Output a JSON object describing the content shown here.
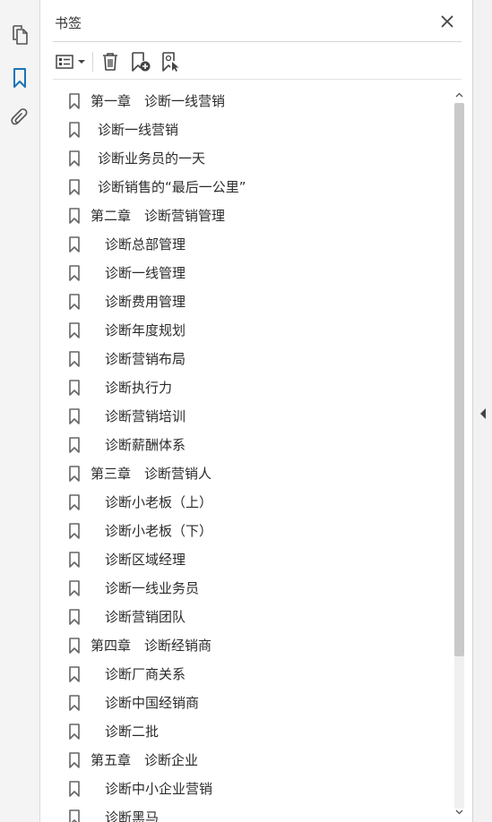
{
  "panel": {
    "title": "书签"
  },
  "rail": {
    "items": [
      {
        "name": "pages-icon"
      },
      {
        "name": "bookmarks-icon"
      },
      {
        "name": "attachments-icon"
      }
    ]
  },
  "toolbar": {
    "options_icon": "list-options-icon",
    "delete_icon": "trash-icon",
    "new_bookmark_icon": "new-bookmark-icon",
    "bookmark_from_selection_icon": "bookmark-from-selection-icon"
  },
  "colors": {
    "accent": "#1a73b8",
    "icon_gray": "#555555",
    "rail_bg": "#f4f4f4"
  },
  "bookmarks": [
    {
      "label": "第一章　诊断一线营销",
      "level": 0
    },
    {
      "label": "诊断一线营销",
      "level": 1
    },
    {
      "label": "诊断业务员的一天",
      "level": 1
    },
    {
      "label": "诊断销售的“最后一公里”",
      "level": 1
    },
    {
      "label": "第二章　诊断营销管理",
      "level": 0
    },
    {
      "label": "诊断总部管理",
      "level": 2
    },
    {
      "label": "诊断一线管理",
      "level": 2
    },
    {
      "label": "诊断费用管理",
      "level": 2
    },
    {
      "label": "诊断年度规划",
      "level": 2
    },
    {
      "label": "诊断营销布局",
      "level": 2
    },
    {
      "label": "诊断执行力",
      "level": 2
    },
    {
      "label": "诊断营销培训",
      "level": 2
    },
    {
      "label": "诊断薪酬体系",
      "level": 2
    },
    {
      "label": "第三章　诊断营销人",
      "level": 0
    },
    {
      "label": "诊断小老板（上）",
      "level": 2
    },
    {
      "label": "诊断小老板（下）",
      "level": 2
    },
    {
      "label": "诊断区域经理",
      "level": 2
    },
    {
      "label": "诊断一线业务员",
      "level": 2
    },
    {
      "label": "诊断营销团队",
      "level": 2
    },
    {
      "label": "第四章　诊断经销商",
      "level": 0
    },
    {
      "label": "诊断厂商关系",
      "level": 2
    },
    {
      "label": "诊断中国经销商",
      "level": 2
    },
    {
      "label": "诊断二批",
      "level": 2
    },
    {
      "label": "第五章　诊断企业",
      "level": 0
    },
    {
      "label": "诊断中小企业营销",
      "level": 2
    },
    {
      "label": "诊断黑马",
      "level": 2
    }
  ]
}
